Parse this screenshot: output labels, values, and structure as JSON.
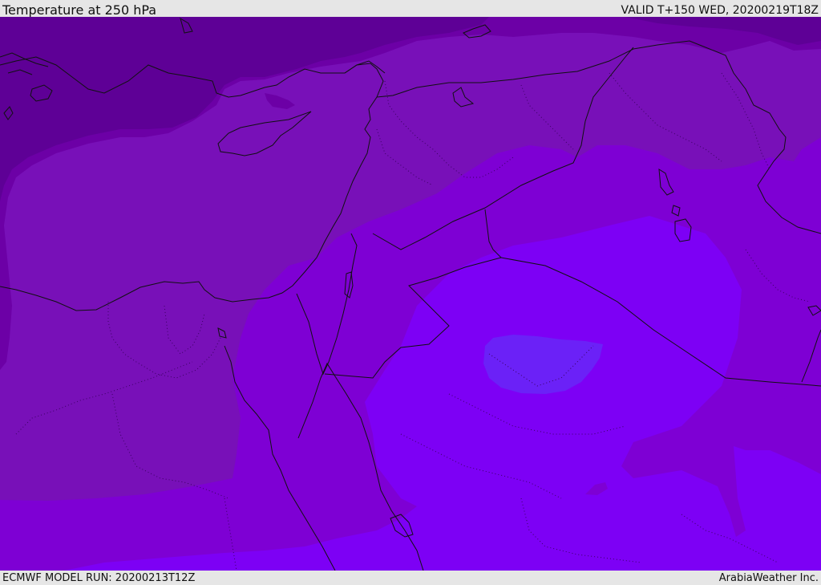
{
  "header": {
    "title": "Temperature at 250 hPa",
    "valid_time": "VALID T+150 WED, 20200219T18Z"
  },
  "footer": {
    "model_run": "ECMWF MODEL RUN: 20200213T12Z",
    "credit": "ArabiaWeather Inc."
  },
  "map": {
    "variable": "temperature",
    "level": "250 hPa",
    "colors": {
      "band_darkest": "#5e0096",
      "band_dark": "#6c00a6",
      "band_mid": "#7810b8",
      "band_violet": "#7e00d4",
      "band_bright": "#7d00f5",
      "band_blue_violet": "#6b21f7",
      "border_line": "#111111",
      "admin_dotted": "#3a0060"
    }
  }
}
